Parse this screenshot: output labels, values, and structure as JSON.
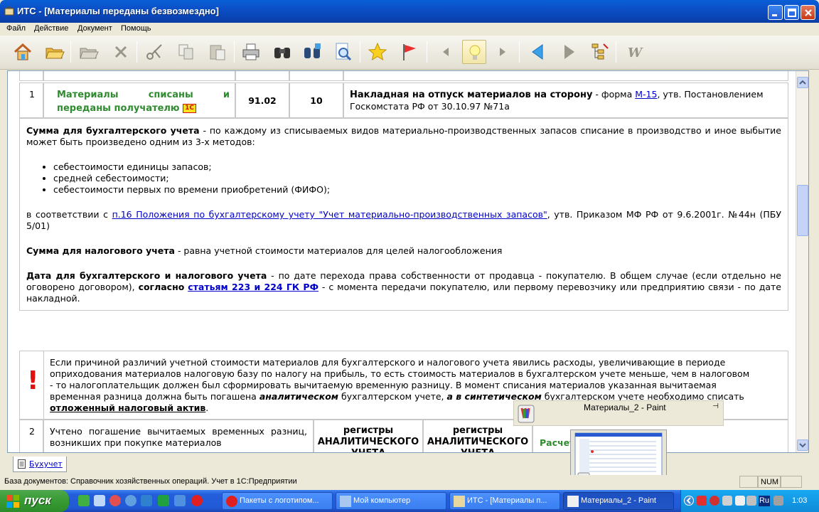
{
  "window": {
    "title": "ИТС - [Материалы переданы безвозмездно]"
  },
  "menu": [
    "Файл",
    "Действие",
    "Документ",
    "Помощь"
  ],
  "toolbar": {
    "icons": [
      "home-icon",
      "folder-open-icon",
      "folder-icon",
      "delete-icon",
      "cut-icon",
      "copy-icon",
      "paste-icon",
      "print-icon",
      "binoculars-icon",
      "find-all-icon",
      "preview-icon",
      "favorites-star-icon",
      "flag-icon",
      "prev-arrow-icon",
      "bulb-icon",
      "next-arrow-icon",
      "back-icon",
      "forward-icon",
      "tree-icon",
      "w-icon"
    ]
  },
  "row1": {
    "num": "1",
    "desc": "Материалы списаны и переданы получателю",
    "badge": "1С",
    "debit": "91.02",
    "credit": "10",
    "doc_bold": "Накладная на отпуск материалов на сторону",
    "doc_mid": " - форма ",
    "doc_link": "М-15",
    "doc_tail": ", утв. Постановлением Госкомстата РФ от 30.10.97 №71а"
  },
  "sum_acc": {
    "label": "Сумма для бухгалтерского учета",
    "text": " - по каждому из списываемых видов материально-производственных запасов списание в производство и иное выбытие может быть произведено одним из 3-х методов:",
    "items": [
      "себестоимости единицы запасов;",
      "средней себестоимости;",
      "себестоимости первых по времени приобретений (ФИФО);"
    ],
    "pre": "в соответствии с ",
    "link": "п.16 Положения по бухгалтерскому учету \"Учет материально-производственных запасов\"",
    "post": ", утв. Приказом МФ РФ от 9.6.2001г. №44н (ПБУ 5/01)"
  },
  "sum_tax": {
    "label": "Сумма для налогового  учета",
    "text": " - равна учетной стоимости материалов для целей налогообложения"
  },
  "date": {
    "label": "Дата для бухгалтерского и налогового учета",
    "text1": " - по дате перехода права собственности от продавца - покупателю. В общем случае (если отдельно не оговорено договором), ",
    "bold2": "согласно",
    "space": " ",
    "link": "статьям 223 и 224 ГК РФ",
    "text2": " - с момента передачи покупателю, или первому перевозчику или предприятию связи - по дате накладной."
  },
  "warning": {
    "mark": "!",
    "t1": "Если причиной различий учетной стоимости материалов для бухгалтерского и налогового учета явились расходы, увеличивающие в периоде оприходования материалов налоговую базу по налогу на прибыль, то есть стоимость материалов в бухгалтерском учете меньше, чем в налоговом - то налогоплательщик должен был сформировать вычитаемую временную разницу. В момент списания материалов указанная вычитаемая временная разница должна быть погашена ",
    "i1": "аналитическом",
    "t2": " бухгалтерском учете, ",
    "i2": "а в синтетическом",
    "t3": " бухгалтерском учете необходимо списать ",
    "u1": "отложенный налоговый актив",
    "t4": "."
  },
  "row2": {
    "num": "2",
    "desc": "Учтено погашение вычитаемых временных разниц, возникших при покупке материалов",
    "col3": "регистры АНАЛИТИЧЕСКОГО УЧЕТА",
    "col4": "регистры АНАЛИТИЧЕСКОГО УЧЕТА",
    "col5": "Расчет"
  },
  "tab": "Бухучет",
  "status": {
    "text": "База документов: Справочник хозяйственных операций. Учет в 1С:Предприятии",
    "num": "NUM"
  },
  "popup": {
    "title": "Материалы_2 - Paint"
  },
  "taskbar": {
    "start": "пуск",
    "tasks": [
      "Пакеты с логотипом...",
      "Мой компьютер",
      "ИТС - [Материалы п...",
      "Материалы_2 - Paint"
    ],
    "lang": "Ru",
    "time": "1:03"
  }
}
